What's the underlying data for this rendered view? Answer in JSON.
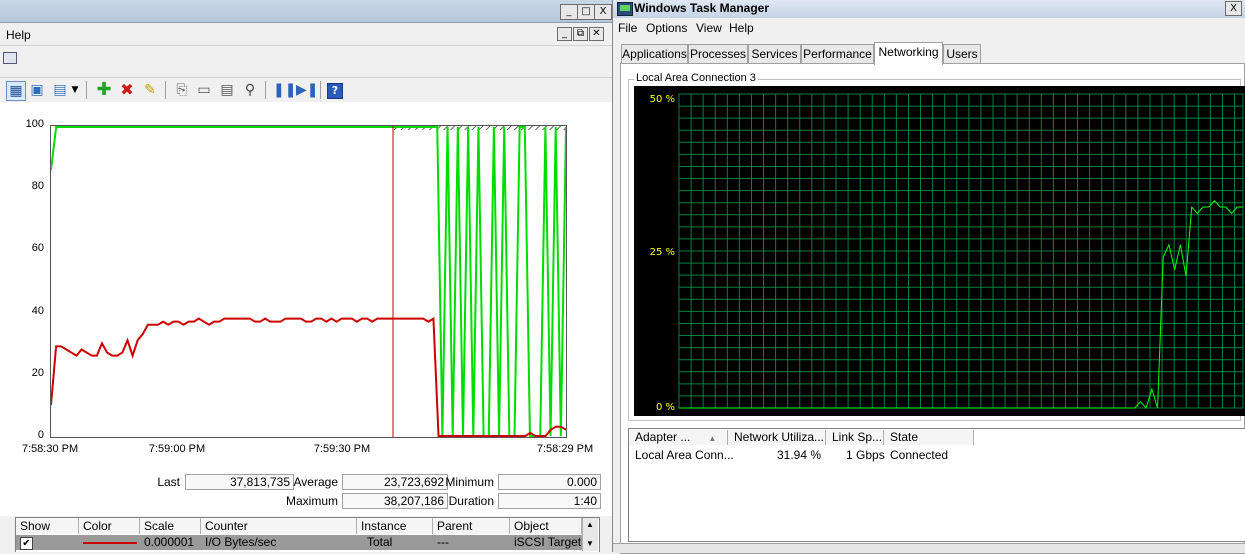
{
  "perfmon": {
    "menu": {
      "help": "Help"
    },
    "window_controls": {
      "minimize": "_",
      "maximize": "□",
      "close": "X"
    },
    "child_controls": {
      "minimize": "_",
      "restore": "⧉",
      "close": "✕"
    },
    "toolbar_icons": [
      "graph-view-icon",
      "change-graph-icon",
      "view-type-icon",
      "dropdown-icon",
      "add-counter-icon",
      "delete-counter-icon",
      "highlight-icon",
      "copy-icon",
      "paste-icon",
      "properties-icon",
      "zoom-icon",
      "freeze-icon",
      "update-icon",
      "help-icon"
    ],
    "stats": {
      "last_label": "Last",
      "last": "37,813,735",
      "average_label": "Average",
      "average": "23,723,692",
      "minimum_label": "Minimum",
      "minimum": "0.000",
      "maximum_label": "Maximum",
      "maximum": "38,207,186",
      "duration_label": "Duration",
      "duration": "1:40"
    },
    "table": {
      "headers": [
        "Show",
        "Color",
        "Scale",
        "Counter",
        "Instance",
        "Parent",
        "Object"
      ],
      "rows": [
        {
          "show": "✔",
          "color": "#cc0000",
          "scale": "0.000001",
          "counter": "I/O Bytes/sec",
          "instance": "Total",
          "parent": "---",
          "object": "iSCSI Target D"
        }
      ]
    }
  },
  "chart_data": [
    {
      "type": "line",
      "xlabel": "",
      "ylabel": "",
      "ylim": [
        0,
        100
      ],
      "yticks": [
        "100",
        "80",
        "60",
        "40",
        "20",
        "0"
      ],
      "xticks": [
        "7:58:30 PM",
        "7:59:00 PM",
        "7:59:30 PM",
        "7:58:29 PM"
      ],
      "grid": false,
      "series": [
        {
          "color": "#00dd00",
          "values": [
            86,
            100,
            100,
            100,
            100,
            100,
            100,
            100,
            100,
            100,
            100,
            100,
            100,
            100,
            100,
            100,
            100,
            100,
            100,
            100,
            100,
            100,
            100,
            100,
            100,
            100,
            100,
            100,
            100,
            100,
            100,
            100,
            100,
            100,
            100,
            100,
            100,
            100,
            100,
            100,
            100,
            100,
            100,
            100,
            100,
            100,
            100,
            100,
            100,
            100,
            100,
            100,
            100,
            100,
            100,
            100,
            100,
            100,
            100,
            100,
            100,
            100,
            100,
            100,
            100,
            100,
            100,
            100,
            100,
            100,
            100,
            100,
            100,
            100,
            100,
            100,
            0,
            100,
            0,
            100,
            0,
            100,
            0,
            100,
            0,
            0,
            100,
            0,
            100,
            0,
            0,
            100,
            100,
            0,
            0,
            0,
            100,
            0,
            100,
            0,
            100
          ]
        },
        {
          "color": "#cc0000",
          "values": [
            10,
            29,
            29,
            28,
            27,
            26,
            28,
            27,
            26,
            26,
            30,
            27,
            26,
            26,
            27,
            31,
            26,
            31,
            33,
            36,
            36,
            36,
            37,
            36,
            37,
            37,
            36,
            37,
            37,
            38,
            37,
            36,
            37,
            37,
            38,
            38,
            38,
            38,
            38,
            38,
            37,
            37,
            38,
            37,
            37,
            37,
            38,
            38,
            38,
            38,
            37,
            37,
            38,
            38,
            37,
            38,
            37,
            38,
            38,
            38,
            37,
            38,
            38,
            37,
            38,
            38,
            38,
            38,
            38,
            38,
            38,
            38,
            38,
            38,
            37,
            38,
            0,
            0,
            0,
            0,
            0,
            0,
            0,
            0,
            0,
            0,
            0,
            0,
            0,
            0,
            0,
            0,
            0,
            0,
            1,
            0,
            0,
            0,
            2,
            3,
            3,
            2
          ]
        }
      ]
    },
    {
      "type": "line",
      "title": "Local Area Connection 3",
      "ylim": [
        0,
        50
      ],
      "yticks": [
        "50 %",
        "25 %",
        "0 %"
      ],
      "grid": true,
      "series": [
        {
          "color": "#00ff00",
          "values": [
            0,
            0,
            0,
            0,
            0,
            0,
            0,
            0,
            0,
            0,
            0,
            0,
            0,
            0,
            0,
            0,
            0,
            0,
            0,
            0,
            0,
            0,
            0,
            0,
            0,
            0,
            0,
            0,
            0,
            0,
            0,
            0,
            0,
            0,
            0,
            0,
            0,
            0,
            0,
            0,
            0,
            0,
            0,
            0,
            0,
            0,
            0,
            0,
            0,
            0,
            0,
            0,
            0,
            0,
            0,
            0,
            0,
            0,
            0,
            0,
            0,
            0,
            0,
            0,
            0,
            0,
            0,
            0,
            0,
            0,
            0,
            0,
            0,
            0,
            0,
            0,
            0,
            0,
            0,
            0,
            0,
            1,
            0,
            3,
            0,
            24,
            26,
            22,
            26,
            21,
            32,
            31,
            32,
            32,
            33,
            32,
            32,
            31,
            32,
            32
          ]
        }
      ]
    }
  ],
  "taskmgr": {
    "title": "Windows Task Manager",
    "close": "X",
    "menu": [
      "File",
      "Options",
      "View",
      "Help"
    ],
    "tabs": [
      "Applications",
      "Processes",
      "Services",
      "Performance",
      "Networking",
      "Users"
    ],
    "active_tab": "Networking",
    "graph_title": "Local Area Connection 3",
    "adapter_table": {
      "headers": [
        "Adapter ...",
        "Network Utiliza...",
        "Link Sp...",
        "State"
      ],
      "rows": [
        {
          "adapter": "Local Area Conn...",
          "utilization": "31.94 %",
          "link_speed": "1 Gbps",
          "state": "Connected"
        }
      ]
    }
  }
}
